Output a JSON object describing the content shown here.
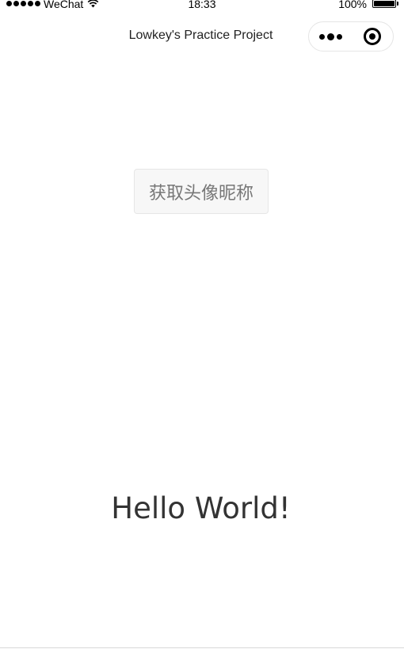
{
  "status_bar": {
    "carrier": "WeChat",
    "time": "18:33",
    "battery": "100%",
    "signal_icon": "signal-dots-icon",
    "wifi_icon": "wifi-icon",
    "battery_icon": "battery-icon"
  },
  "nav": {
    "title": "Lowkey's Practice Project",
    "more_icon": "more-dots-icon",
    "close_icon": "target-close-icon"
  },
  "main": {
    "get_profile_button": "获取头像昵称",
    "hello": "Hello World!"
  }
}
